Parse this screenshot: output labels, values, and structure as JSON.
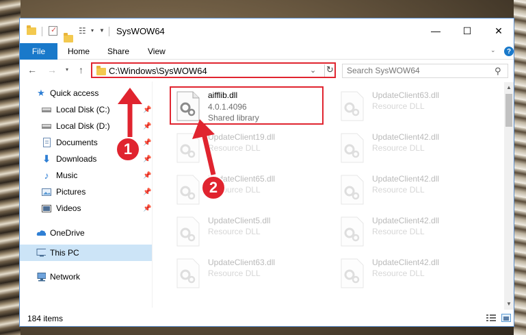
{
  "window": {
    "title": "SysWOW64"
  },
  "window_controls": {
    "minimize": "—",
    "maximize": "☐",
    "close": "✕"
  },
  "ribbon": {
    "file": "File",
    "home": "Home",
    "share": "Share",
    "view": "View",
    "help": "?"
  },
  "address": {
    "path": "C:\\Windows\\SysWOW64"
  },
  "search": {
    "placeholder": "Search SysWOW64"
  },
  "sidebar": {
    "items": [
      {
        "label": "Quick access",
        "icon": "star-icon",
        "pinned": false
      },
      {
        "label": "Local Disk (C:)",
        "icon": "drive-icon",
        "pinned": true
      },
      {
        "label": "Local Disk (D:)",
        "icon": "drive-icon",
        "pinned": true
      },
      {
        "label": "Documents",
        "icon": "document-icon",
        "pinned": true
      },
      {
        "label": "Downloads",
        "icon": "download-icon",
        "pinned": true
      },
      {
        "label": "Music",
        "icon": "music-icon",
        "pinned": true
      },
      {
        "label": "Pictures",
        "icon": "pictures-icon",
        "pinned": true
      },
      {
        "label": "Videos",
        "icon": "video-icon",
        "pinned": true
      },
      {
        "label": "OneDrive",
        "icon": "cloud-icon",
        "pinned": false
      },
      {
        "label": "This PC",
        "icon": "computer-icon",
        "pinned": false,
        "selected": true
      },
      {
        "label": "Network",
        "icon": "network-icon",
        "pinned": false
      }
    ]
  },
  "files": [
    {
      "name": "aifflib.dll",
      "version": "4.0.1.4096",
      "type": "Shared library"
    },
    {
      "name": "UpdateClient63.dll",
      "type": "Resource DLL"
    },
    {
      "name": "UpdateClient19.dll",
      "type": "Resource DLL"
    },
    {
      "name": "UpdateClient42.dll",
      "type": "Resource DLL"
    },
    {
      "name": "UpdateClient65.dll",
      "type": "Resource DLL"
    },
    {
      "name": "UpdateClient42.dll",
      "type": "Resource DLL"
    },
    {
      "name": "UpdateClient5.dll",
      "type": "Resource DLL"
    },
    {
      "name": "UpdateClient42.dll",
      "type": "Resource DLL"
    },
    {
      "name": "UpdateClient63.dll",
      "type": "Resource DLL"
    },
    {
      "name": "UpdateClient42.dll",
      "type": "Resource DLL"
    }
  ],
  "status": {
    "count": "184 items"
  },
  "annotations": {
    "step1": "1",
    "step2": "2"
  },
  "colors": {
    "accent": "#1979ca",
    "highlight": "#e0242f",
    "selected": "#cce4f7"
  }
}
